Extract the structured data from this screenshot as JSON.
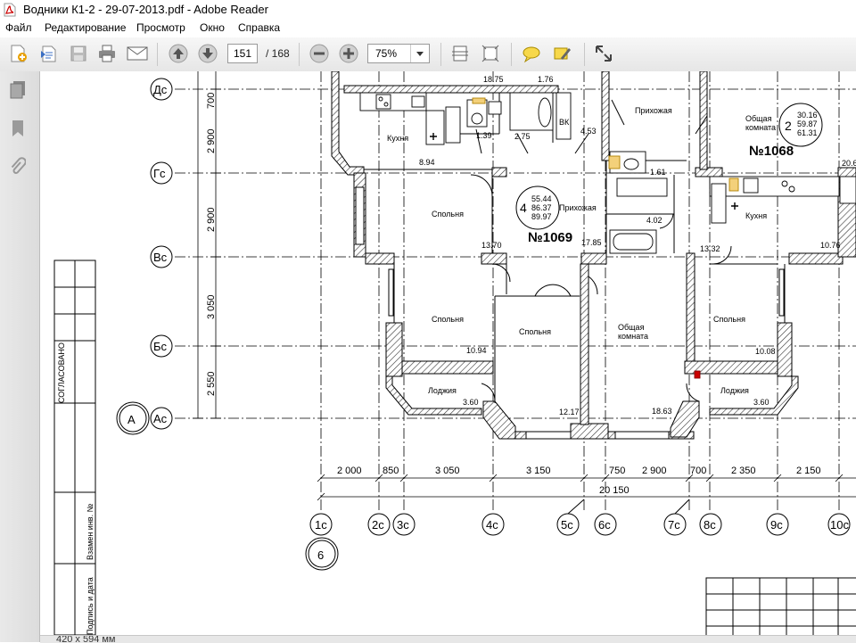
{
  "window": {
    "title": "Водники К1-2 - 29-07-2013.pdf - Adobe Reader"
  },
  "menu": [
    "Файл",
    "Редактирование",
    "Просмотр",
    "Окно",
    "Справка"
  ],
  "toolbar": {
    "page_current": "151",
    "page_total": "/ 168",
    "zoom": "75%"
  },
  "status": {
    "page_size": "420 x 594 мм"
  },
  "drawing": {
    "row_axes": [
      "Дс",
      "Гс",
      "Вс",
      "Бс",
      "Ас"
    ],
    "row_dims": [
      "700",
      "2 900",
      "2 900",
      "3 050",
      "2 550"
    ],
    "col_axes": [
      "1с",
      "2с",
      "3с",
      "4с",
      "5с",
      "6с",
      "7с",
      "8с",
      "9с",
      "10с"
    ],
    "col_dims": [
      "2 000",
      "850",
      "3 050",
      "3 150",
      "750",
      "2 900",
      "700",
      "2 350",
      "2 150"
    ],
    "total_dim": "20 150",
    "section_letter": "А",
    "section_number": "6",
    "stamp_left_labels": [
      "СОГЛАСОВАНО",
      "Взамен инв. №",
      "Подпись и дата"
    ],
    "apt_1069": {
      "number": "№1069",
      "rooms": "4",
      "area_living": "55.44",
      "area_total": "86.37",
      "area_full": "89.97"
    },
    "apt_1068": {
      "number": "№1068",
      "rooms": "2",
      "area_living": "30.16",
      "area_total": "59.87",
      "area_full": "61.31"
    },
    "rooms": [
      {
        "name": "Кухня",
        "area": "8.94"
      },
      {
        "name": "Спольня",
        "area": "13.70"
      },
      {
        "name": "Прихожая",
        "area": "17.85"
      },
      {
        "name": "Спольня",
        "area": "10.94"
      },
      {
        "name": "Спольня",
        "area": "12.17"
      },
      {
        "name": "Лоджия",
        "area": "3.60"
      },
      {
        "name": "Общая комната",
        "area": "18.63"
      },
      {
        "name": "Прихожая",
        "area": "4.02"
      },
      {
        "name": "Общая комната",
        "area": ""
      },
      {
        "name": "Кухня",
        "area": "10.76"
      },
      {
        "name": "Спольня",
        "area": "10.08"
      },
      {
        "name": "Лоджия",
        "area": "3.60"
      }
    ],
    "small_areas": [
      "18.75",
      "1.76",
      "1.39",
      "2.75",
      "4.53",
      "1.61",
      "13.32",
      "20.6"
    ],
    "vk_label": "ВК"
  },
  "icons": {
    "app": "pdf-icon",
    "colors": {
      "brand": "#cc0000",
      "toolbar_bg": "#ececec"
    }
  }
}
